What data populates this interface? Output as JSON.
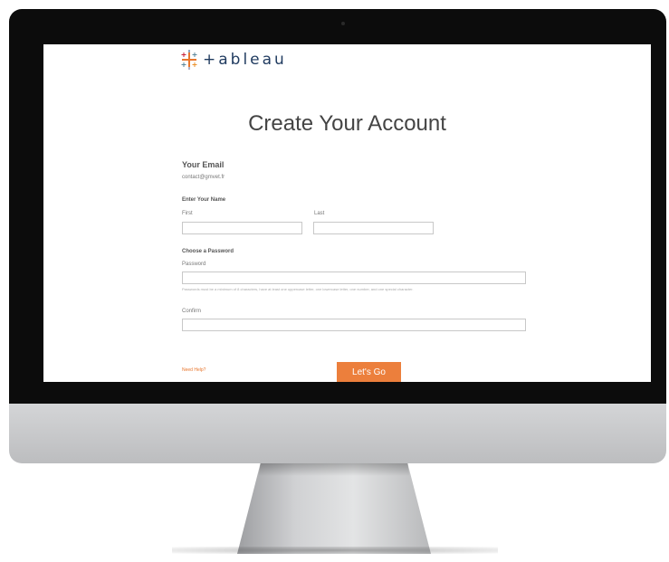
{
  "logo": {
    "text": "+ableau"
  },
  "form": {
    "title": "Create Your Account",
    "email_heading": "Your Email",
    "email_value": "contact@gmvet.fr",
    "name_heading": "Enter Your Name",
    "first_label": "First",
    "last_label": "Last",
    "password_heading": "Choose a Password",
    "password_label": "Password",
    "password_hint": "Passwords must be a minimum of 8 characters, have at least one uppercase letter, one lowercase letter, one number, and one special character.",
    "confirm_label": "Confirm",
    "help_link": "Need Help?",
    "submit_label": "Let's Go"
  },
  "colors": {
    "accent": "#ec7f3c",
    "bezel": "#0c0c0c",
    "logo_text": "#1f3a5f"
  }
}
